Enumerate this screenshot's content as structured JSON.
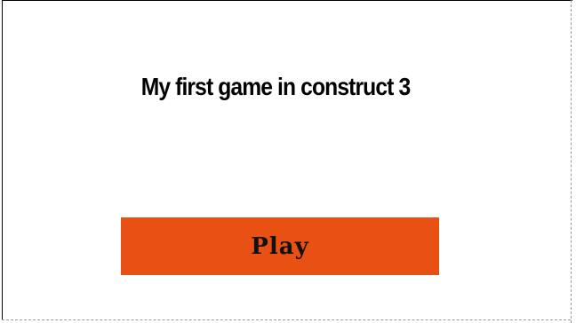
{
  "game": {
    "title": "My first game in construct 3",
    "play_label": "Play",
    "colors": {
      "background": "#ffffff",
      "button": "#e85014",
      "text": "#000000"
    }
  }
}
